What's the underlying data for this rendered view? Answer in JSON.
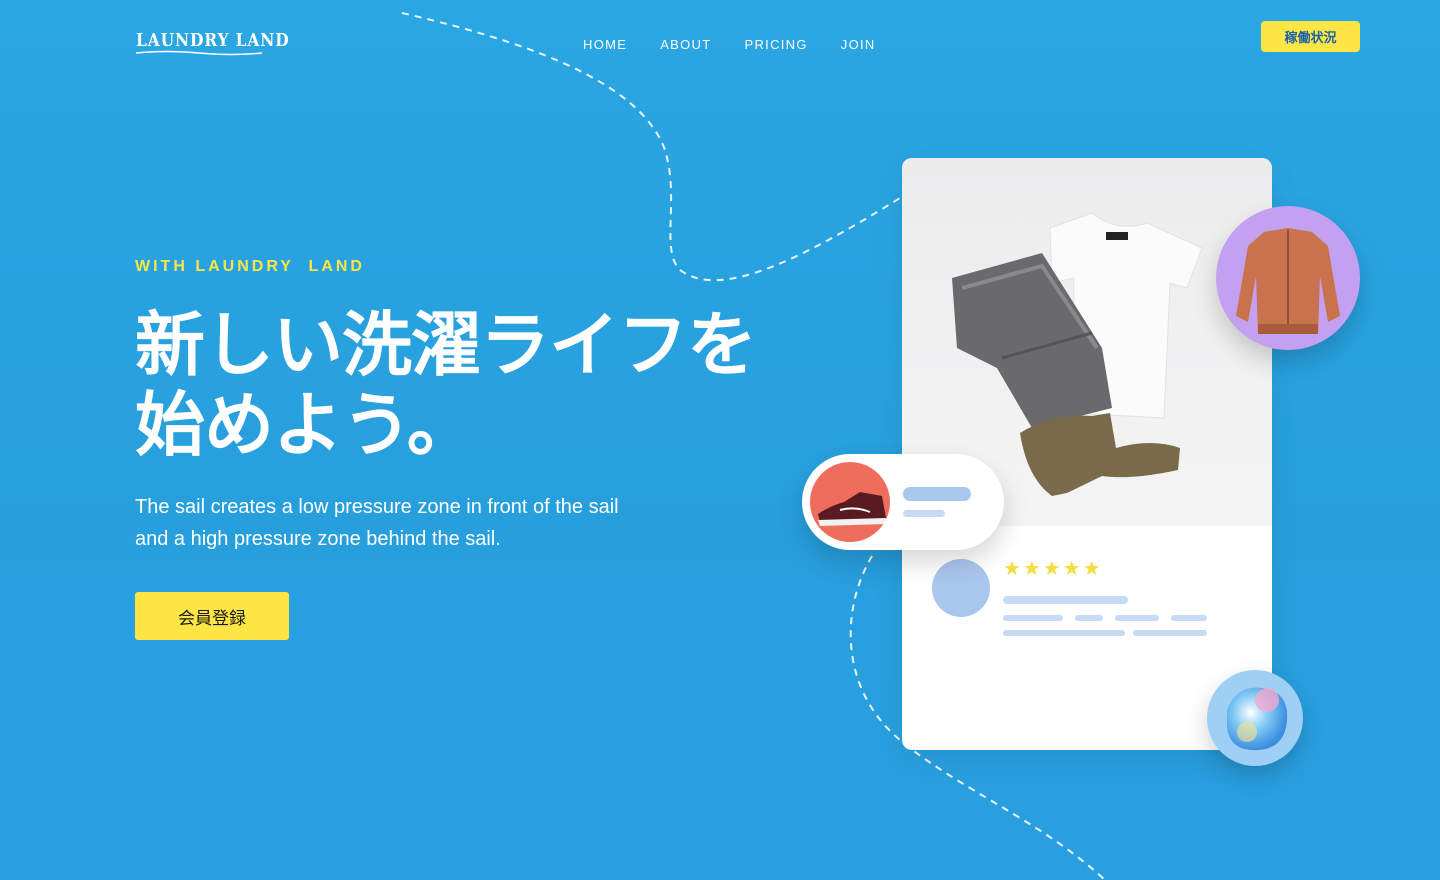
{
  "header": {
    "logo_text": "LAUNDRY LAND",
    "nav": [
      "HOME",
      "ABOUT",
      "PRICING",
      "JOIN"
    ],
    "status_button": "稼働状況"
  },
  "hero": {
    "eyebrow": "WITH LAUNDRY  LAND",
    "title_line1": "新しい洗濯ライフを",
    "title_line2": "始めよう。",
    "description": "The sail creates a low pressure zone in front of the sail and a high pressure zone behind the sail.",
    "cta": "会員登録"
  },
  "review_card": {
    "stars": "★★★★★",
    "rating": 5
  },
  "colors": {
    "background": "#29a3e0",
    "accent_yellow": "#fde545",
    "card": "#ffffff",
    "placeholder_blue": "#c7daf4"
  },
  "icons": [
    "sneaker-image",
    "jacket-image",
    "detergent-pod-image",
    "clothes-flatlay-image"
  ]
}
